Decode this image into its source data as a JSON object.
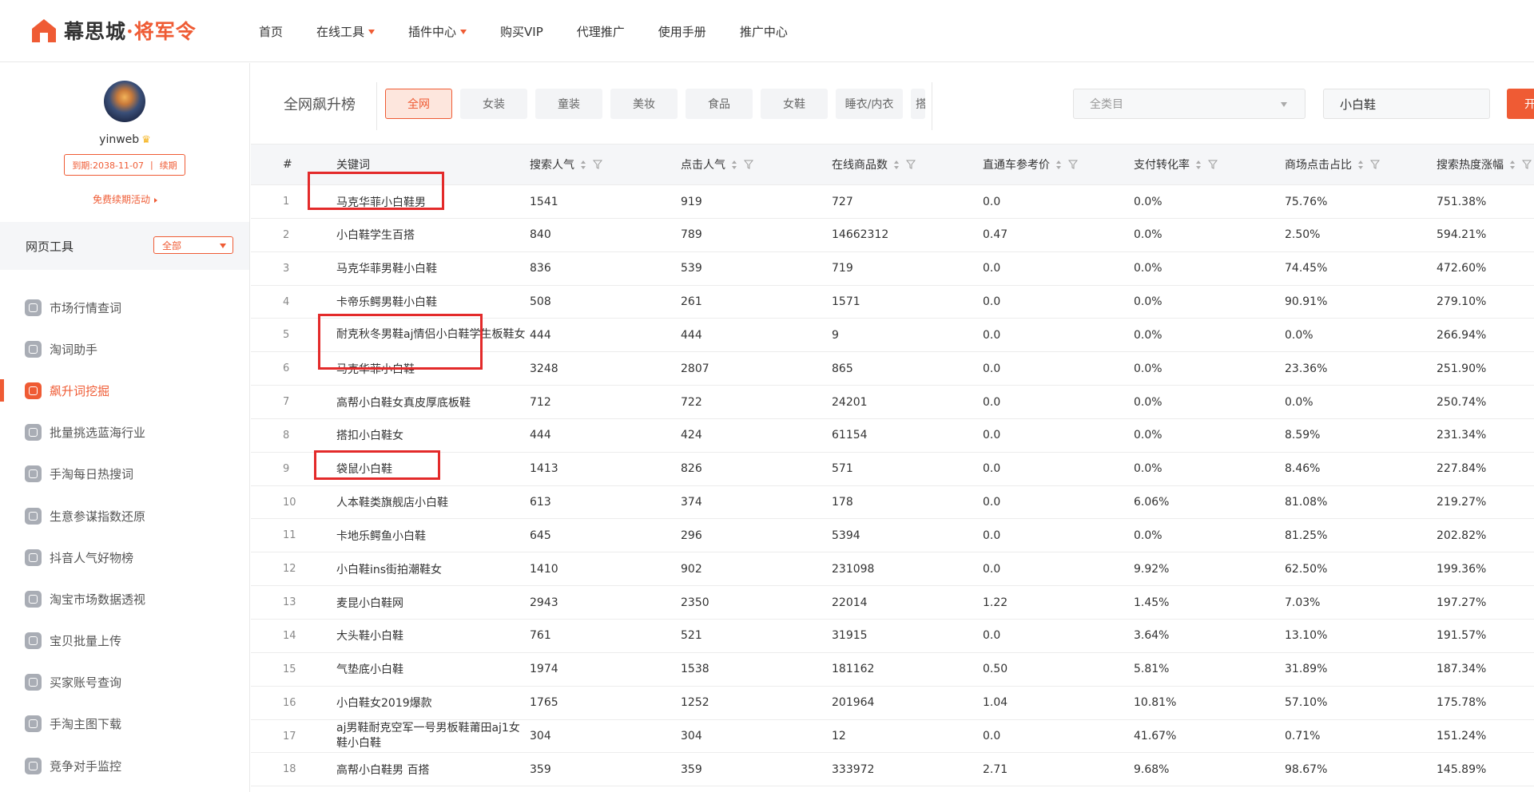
{
  "header": {
    "logo_primary": "幕思城",
    "logo_dot": "·",
    "logo_secondary": "将军令",
    "nav": [
      {
        "label": "首页",
        "dropdown": false
      },
      {
        "label": "在线工具",
        "dropdown": true
      },
      {
        "label": "插件中心",
        "dropdown": true
      },
      {
        "label": "购买VIP",
        "dropdown": false
      },
      {
        "label": "代理推广",
        "dropdown": false
      },
      {
        "label": "使用手册",
        "dropdown": false
      },
      {
        "label": "推广中心",
        "dropdown": false
      }
    ]
  },
  "sidebar": {
    "username": "yinweb",
    "expire_text": "到期:2038-11-07",
    "renew_label": "续期",
    "free_activity": "免费续期活动",
    "tools_title": "网页工具",
    "tools_filter": "全部",
    "items": [
      {
        "label": "市场行情查词",
        "icon": "chat-icon",
        "active": false
      },
      {
        "label": "淘词助手",
        "icon": "doc-icon",
        "active": false
      },
      {
        "label": "飙升词挖掘",
        "icon": "trend-icon",
        "active": true
      },
      {
        "label": "批量挑选蓝海行业",
        "icon": "compass-icon",
        "active": false
      },
      {
        "label": "手淘每日热搜词",
        "icon": "fire-icon",
        "active": false
      },
      {
        "label": "生意参谋指数还原",
        "icon": "chart-icon",
        "active": false
      },
      {
        "label": "抖音人气好物榜",
        "icon": "music-icon",
        "active": false
      },
      {
        "label": "淘宝市场数据透视",
        "icon": "gauge-icon",
        "active": false
      },
      {
        "label": "宝贝批量上传",
        "icon": "upload-icon",
        "active": false
      },
      {
        "label": "买家账号查询",
        "icon": "id-card-icon",
        "active": false
      },
      {
        "label": "手淘主图下载",
        "icon": "image-icon",
        "active": false
      },
      {
        "label": "竞争对手监控",
        "icon": "monitor-icon",
        "active": false
      }
    ]
  },
  "filter": {
    "title": "全网飙升榜",
    "categories": [
      "全网",
      "女装",
      "童装",
      "美妆",
      "食品",
      "女鞋",
      "睡衣/内衣"
    ],
    "cut_category": "搭",
    "active_category": 0,
    "category_select_placeholder": "全类目",
    "keyword_value": "小白鞋",
    "submit_label": "开"
  },
  "table": {
    "headers": [
      "#",
      "关键词",
      "搜索人气",
      "点击人气",
      "在线商品数",
      "直通车参考价",
      "支付转化率",
      "商场点击占比",
      "搜索热度涨幅"
    ],
    "rows": [
      [
        "1",
        "马克华菲小白鞋男",
        "1541",
        "919",
        "727",
        "0.0",
        "0.0%",
        "75.76%",
        "751.38%"
      ],
      [
        "2",
        "小白鞋学生百搭",
        "840",
        "789",
        "14662312",
        "0.47",
        "0.0%",
        "2.50%",
        "594.21%"
      ],
      [
        "3",
        "马克华菲男鞋小白鞋",
        "836",
        "539",
        "719",
        "0.0",
        "0.0%",
        "74.45%",
        "472.60%"
      ],
      [
        "4",
        "卡帝乐鳄男鞋小白鞋",
        "508",
        "261",
        "1571",
        "0.0",
        "0.0%",
        "90.91%",
        "279.10%"
      ],
      [
        "5",
        "耐克秋冬男鞋aj情侣小白鞋学生板鞋女",
        "444",
        "444",
        "9",
        "0.0",
        "0.0%",
        "0.0%",
        "266.94%"
      ],
      [
        "6",
        "马克华菲小白鞋",
        "3248",
        "2807",
        "865",
        "0.0",
        "0.0%",
        "23.36%",
        "251.90%"
      ],
      [
        "7",
        "高帮小白鞋女真皮厚底板鞋",
        "712",
        "722",
        "24201",
        "0.0",
        "0.0%",
        "0.0%",
        "250.74%"
      ],
      [
        "8",
        "搭扣小白鞋女",
        "444",
        "424",
        "61154",
        "0.0",
        "0.0%",
        "8.59%",
        "231.34%"
      ],
      [
        "9",
        "袋鼠小白鞋",
        "1413",
        "826",
        "571",
        "0.0",
        "0.0%",
        "8.46%",
        "227.84%"
      ],
      [
        "10",
        "人本鞋类旗舰店小白鞋",
        "613",
        "374",
        "178",
        "0.0",
        "6.06%",
        "81.08%",
        "219.27%"
      ],
      [
        "11",
        "卡地乐鳄鱼小白鞋",
        "645",
        "296",
        "5394",
        "0.0",
        "0.0%",
        "81.25%",
        "202.82%"
      ],
      [
        "12",
        "小白鞋ins街拍潮鞋女",
        "1410",
        "902",
        "231098",
        "0.0",
        "9.92%",
        "62.50%",
        "199.36%"
      ],
      [
        "13",
        "麦昆小白鞋网",
        "2943",
        "2350",
        "22014",
        "1.22",
        "1.45%",
        "7.03%",
        "197.27%"
      ],
      [
        "14",
        "大头鞋小白鞋",
        "761",
        "521",
        "31915",
        "0.0",
        "3.64%",
        "13.10%",
        "191.57%"
      ],
      [
        "15",
        "气垫底小白鞋",
        "1974",
        "1538",
        "181162",
        "0.50",
        "5.81%",
        "31.89%",
        "187.34%"
      ],
      [
        "16",
        "小白鞋女2019爆款",
        "1765",
        "1252",
        "201964",
        "1.04",
        "10.81%",
        "57.10%",
        "175.78%"
      ],
      [
        "17",
        "aj男鞋耐克空军一号男板鞋莆田aj1女鞋小白鞋",
        "304",
        "304",
        "12",
        "0.0",
        "41.67%",
        "0.71%",
        "151.24%"
      ],
      [
        "18",
        "高帮小白鞋男 百搭",
        "359",
        "359",
        "333972",
        "2.71",
        "9.68%",
        "98.67%",
        "145.89%"
      ]
    ]
  },
  "colors": {
    "accent": "#ef5b34",
    "highlight": "#e32a2a"
  }
}
